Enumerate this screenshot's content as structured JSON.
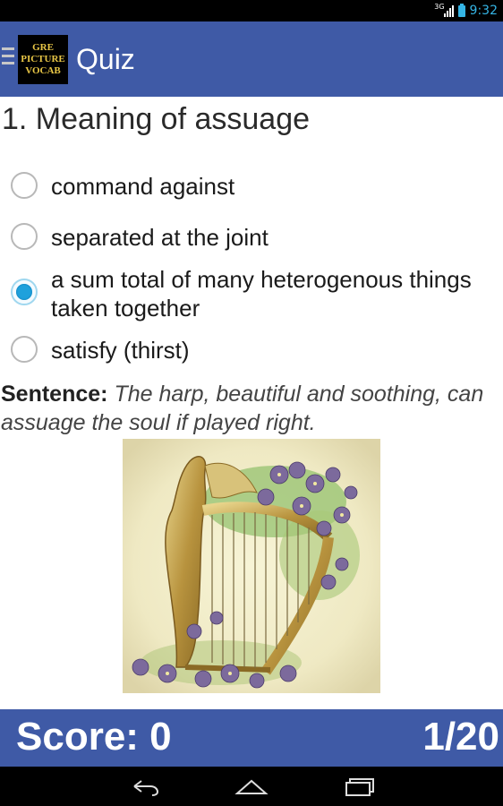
{
  "status_bar": {
    "network": "3G",
    "time": "9:32"
  },
  "app_bar": {
    "logo_lines": [
      "GRE",
      "PICTURE",
      "VOCAB"
    ],
    "title": "Quiz"
  },
  "question": {
    "text": "1. Meaning of assuage"
  },
  "options": [
    {
      "label": "command against",
      "selected": false
    },
    {
      "label": "separated at the joint",
      "selected": false
    },
    {
      "label": "a sum total of many heterogenous things taken together",
      "selected": true
    },
    {
      "label": "satisfy (thirst)",
      "selected": false
    }
  ],
  "sentence": {
    "label": "Sentence:",
    "text": "The harp, beautiful and soothing, can assuage the soul if played right."
  },
  "image": {
    "subject": "vintage golden harp with violets illustration"
  },
  "footer": {
    "score": "Score: 0",
    "progress": "1/20"
  },
  "nav_bar": {
    "icons": [
      "back-icon",
      "home-icon",
      "recent-apps-icon"
    ]
  },
  "colors": {
    "primary": "#3f5aa6",
    "radio_selected": "#1ea1dc",
    "status_accent": "#35b5e5"
  }
}
